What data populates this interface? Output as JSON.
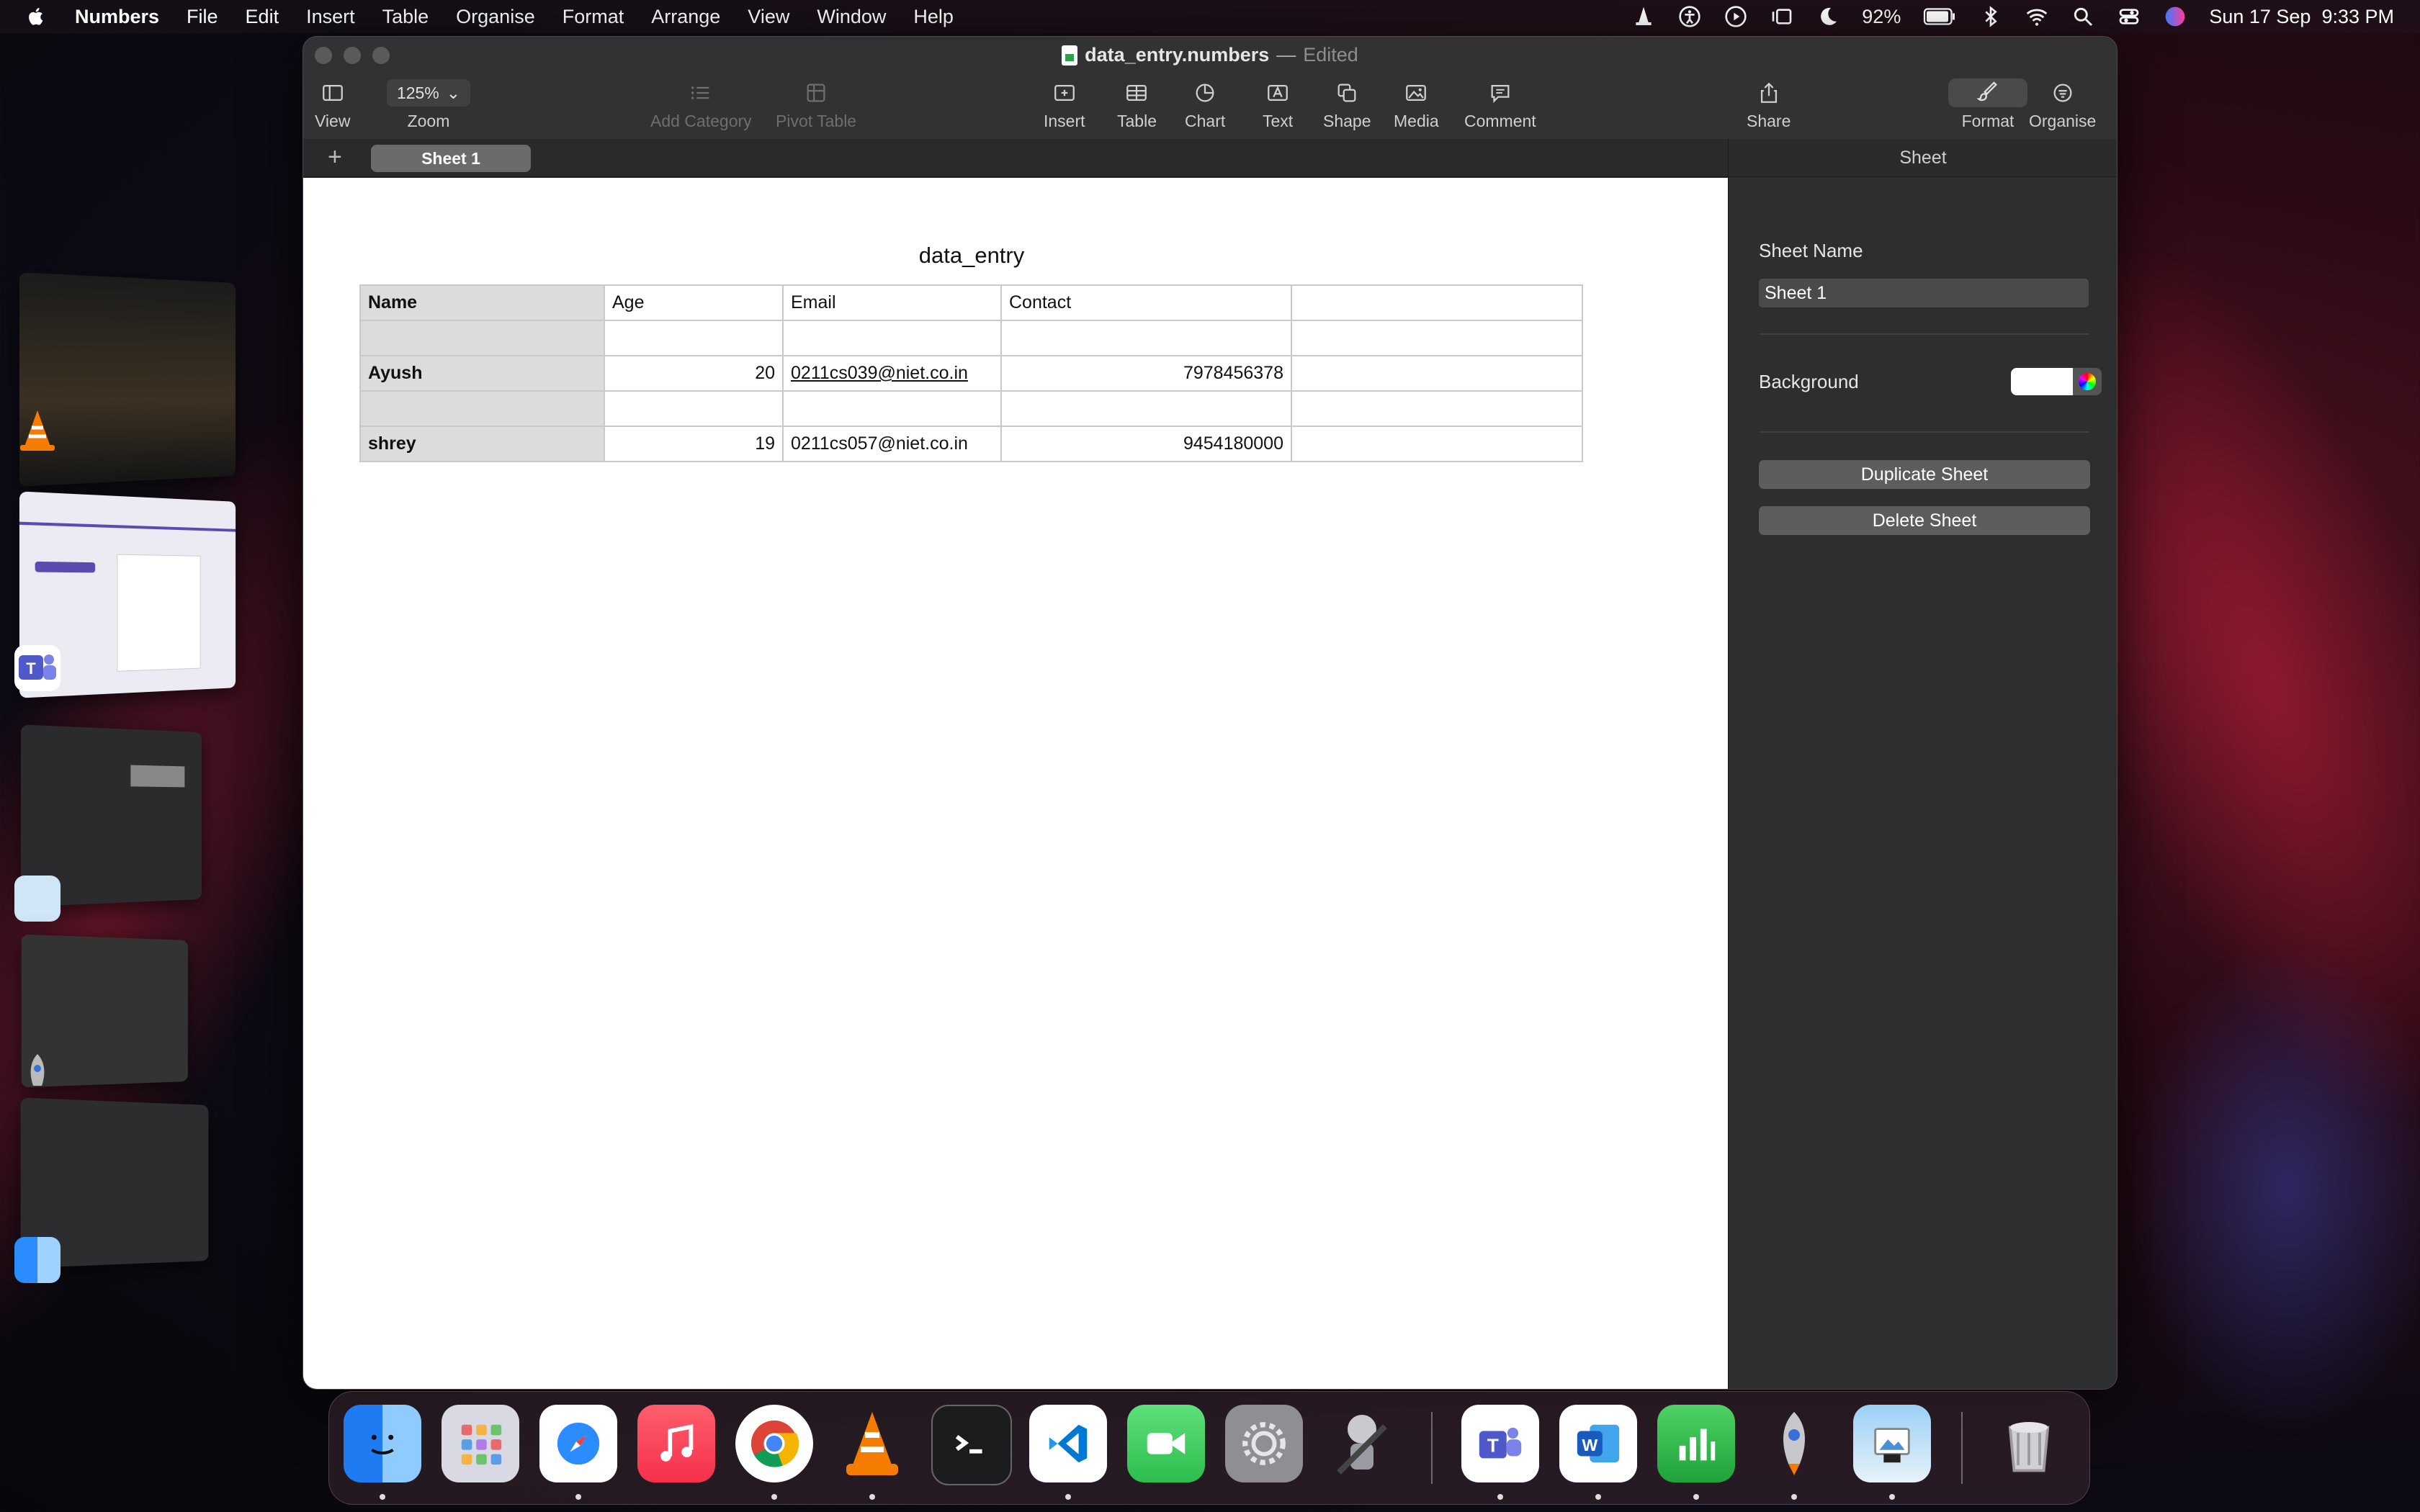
{
  "menubar": {
    "app_name": "Numbers",
    "items": [
      "File",
      "Edit",
      "Insert",
      "Table",
      "Organise",
      "Format",
      "Arrange",
      "View",
      "Window",
      "Help"
    ],
    "battery": "92%",
    "datetime": "Sun 17 Sep  9:33 PM"
  },
  "window": {
    "filename": "data_entry.numbers",
    "separator": "—",
    "status": "Edited"
  },
  "toolbar": {
    "view": "View",
    "zoom_value": "125%",
    "zoom": "Zoom",
    "add_category": "Add Category",
    "pivot_table": "Pivot Table",
    "insert": "Insert",
    "table": "Table",
    "chart": "Chart",
    "text": "Text",
    "shape": "Shape",
    "media": "Media",
    "comment": "Comment",
    "share": "Share",
    "format": "Format",
    "organise": "Organise"
  },
  "tabs": {
    "add": "+",
    "sheet": "Sheet 1"
  },
  "sheet": {
    "table_title": "data_entry",
    "rows": [
      [
        "Name",
        "Age",
        "Email",
        "Contact",
        ""
      ],
      [
        "",
        "",
        "",
        "",
        ""
      ],
      [
        "Ayush",
        "20",
        "0211cs039@niet.co.in",
        "7978456378",
        ""
      ],
      [
        "",
        "",
        "",
        "",
        ""
      ],
      [
        "shrey",
        "19",
        "0211cs057@niet.co.in",
        "9454180000",
        ""
      ]
    ]
  },
  "inspector": {
    "header": "Sheet",
    "sheet_name_label": "Sheet Name",
    "sheet_name_value": "Sheet 1",
    "background_label": "Background",
    "background_color": "#ffffff",
    "duplicate": "Duplicate Sheet",
    "delete": "Delete Sheet"
  },
  "colors": {
    "window_bg": "#2b2b2d",
    "header_cell": "#dcdcdc",
    "canvas": "#ffffff"
  }
}
